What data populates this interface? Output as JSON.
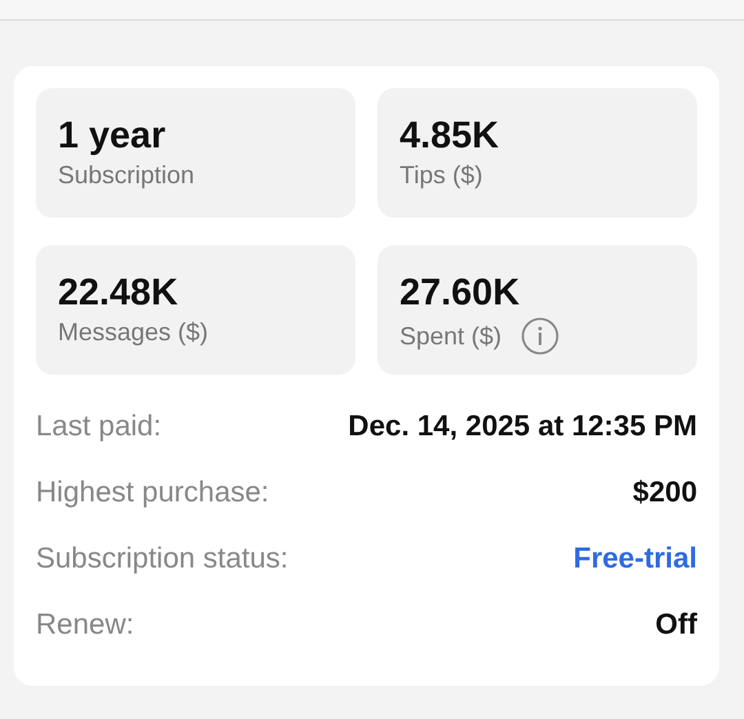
{
  "stats": [
    {
      "value": "1 year",
      "label": "Subscription",
      "info": false
    },
    {
      "value": "4.85K",
      "label": "Tips ($)",
      "info": false
    },
    {
      "value": "22.48K",
      "label": "Messages ($)",
      "info": false
    },
    {
      "value": "27.60K",
      "label": "Spent ($)",
      "info": true
    }
  ],
  "details": [
    {
      "label": "Last paid:",
      "value": "Dec. 14, 2025 at 12:35 PM",
      "kind": "plain"
    },
    {
      "label": "Highest purchase:",
      "value": "$200",
      "kind": "plain"
    },
    {
      "label": "Subscription status:",
      "value": "Free-trial",
      "kind": "link"
    },
    {
      "label": "Renew:",
      "value": "Off",
      "kind": "plain"
    }
  ]
}
